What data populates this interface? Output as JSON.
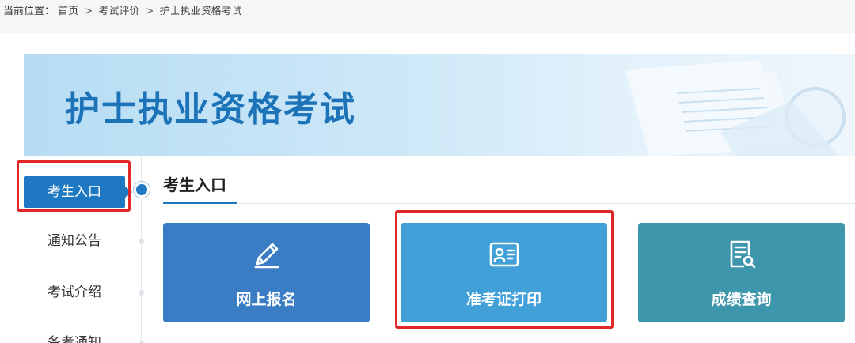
{
  "breadcrumb": {
    "prefix": "当前位置：",
    "items": [
      "首页",
      "考试评价",
      "护士执业资格考试"
    ],
    "separator": ">"
  },
  "banner": {
    "title": "护士执业资格考试"
  },
  "sidebar": {
    "items": [
      {
        "label": "考生入口",
        "active": true
      },
      {
        "label": "通知公告",
        "active": false
      },
      {
        "label": "考试介绍",
        "active": false
      },
      {
        "label": "备考通知",
        "active": false
      }
    ]
  },
  "section": {
    "title": "考生入口"
  },
  "cards": [
    {
      "label": "网上报名",
      "icon": "pencil-icon",
      "color": "#3b7dc4"
    },
    {
      "label": "准考证打印",
      "icon": "id-card-icon",
      "color": "#42a0d8"
    },
    {
      "label": "成绩查询",
      "icon": "document-search-icon",
      "color": "#3e96ad"
    }
  ],
  "colors": {
    "accent": "#1e78c2",
    "highlight": "#e02828"
  }
}
